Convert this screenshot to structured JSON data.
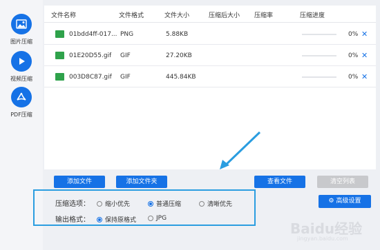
{
  "sidebar": {
    "items": [
      {
        "label": "图片压缩",
        "icon": "image-icon"
      },
      {
        "label": "视频压缩",
        "icon": "play-icon"
      },
      {
        "label": "PDF压缩",
        "icon": "pdf-icon"
      }
    ]
  },
  "table": {
    "columns": [
      "文件名称",
      "文件格式",
      "文件大小",
      "压缩后大小",
      "压缩率",
      "压缩进度"
    ],
    "rows": [
      {
        "name": "01bdd4ff-017...",
        "format": "PNG",
        "size": "5.88KB",
        "progress": "0%",
        "progress_value": 0
      },
      {
        "name": "01E20D55.gif",
        "format": "GIF",
        "size": "27.20KB",
        "progress": "0%",
        "progress_value": 0
      },
      {
        "name": "003D8C87.gif",
        "format": "GIF",
        "size": "445.84KB",
        "progress": "0%",
        "progress_value": 0
      }
    ],
    "delete_glyph": "✕"
  },
  "buttons": {
    "add_file": "添加文件",
    "add_folder": "添加文件夹",
    "view_files": "查看文件",
    "clear_list": "清空列表",
    "advanced": "高级设置"
  },
  "options": {
    "compress_label": "压缩选项：",
    "compress_opts": [
      "缩小优先",
      "普通压缩",
      "清晰优先"
    ],
    "compress_selected": "普通压缩",
    "output_label": "输出格式：",
    "output_opts": [
      "保持原格式",
      "JPG"
    ],
    "output_selected": "保持原格式"
  },
  "watermark": {
    "brand": "Baidu经验",
    "url": "jingyan.baidu.com"
  },
  "colors": {
    "accent": "#1672e6",
    "highlight_box": "#2a9de0",
    "file_icon": "#2fa24b"
  }
}
